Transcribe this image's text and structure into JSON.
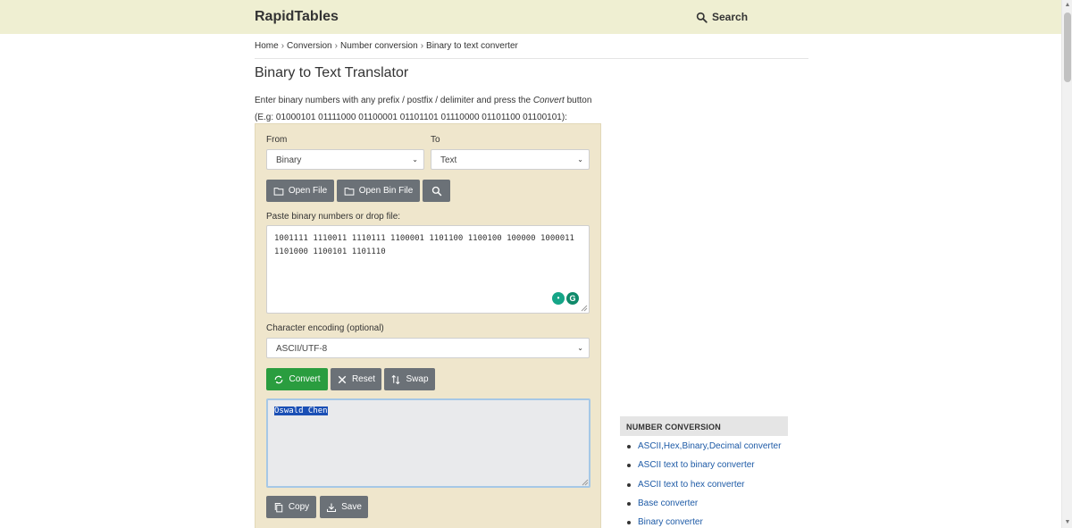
{
  "header": {
    "logo": "RapidTables",
    "search_label": "Search"
  },
  "breadcrumb": [
    "Home",
    "Conversion",
    "Number conversion",
    "Binary to text converter"
  ],
  "page": {
    "title": "Binary to Text Translator",
    "desc_line1_pre": "Enter binary numbers with any prefix / postfix / delimiter and press the ",
    "desc_line1_em": "Convert",
    "desc_line1_post": " button",
    "desc_line2": "(E.g: 01000101 01111000 01100001 01101101 01110000 01101100 01100101):"
  },
  "converter": {
    "from_label": "From",
    "to_label": "To",
    "from_value": "Binary",
    "to_value": "Text",
    "open_file": "Open File",
    "open_bin_file": "Open Bin File",
    "paste_label": "Paste binary numbers or drop file:",
    "input_value": "1001111 1110011 1110111 1100001 1101100 1100100 100000 1000011\n1101000 1100101 1101110",
    "encoding_label": "Character encoding (optional)",
    "encoding_value": "ASCII/UTF-8",
    "convert": "Convert",
    "reset": "Reset",
    "swap": "Swap",
    "output_value": "Oswald Chen",
    "copy": "Copy",
    "save": "Save"
  },
  "sidebar": {
    "heading": "NUMBER CONVERSION",
    "links": [
      "ASCII,Hex,Binary,Decimal converter",
      "ASCII text to binary converter",
      "ASCII text to hex converter",
      "Base converter",
      "Binary converter"
    ]
  }
}
